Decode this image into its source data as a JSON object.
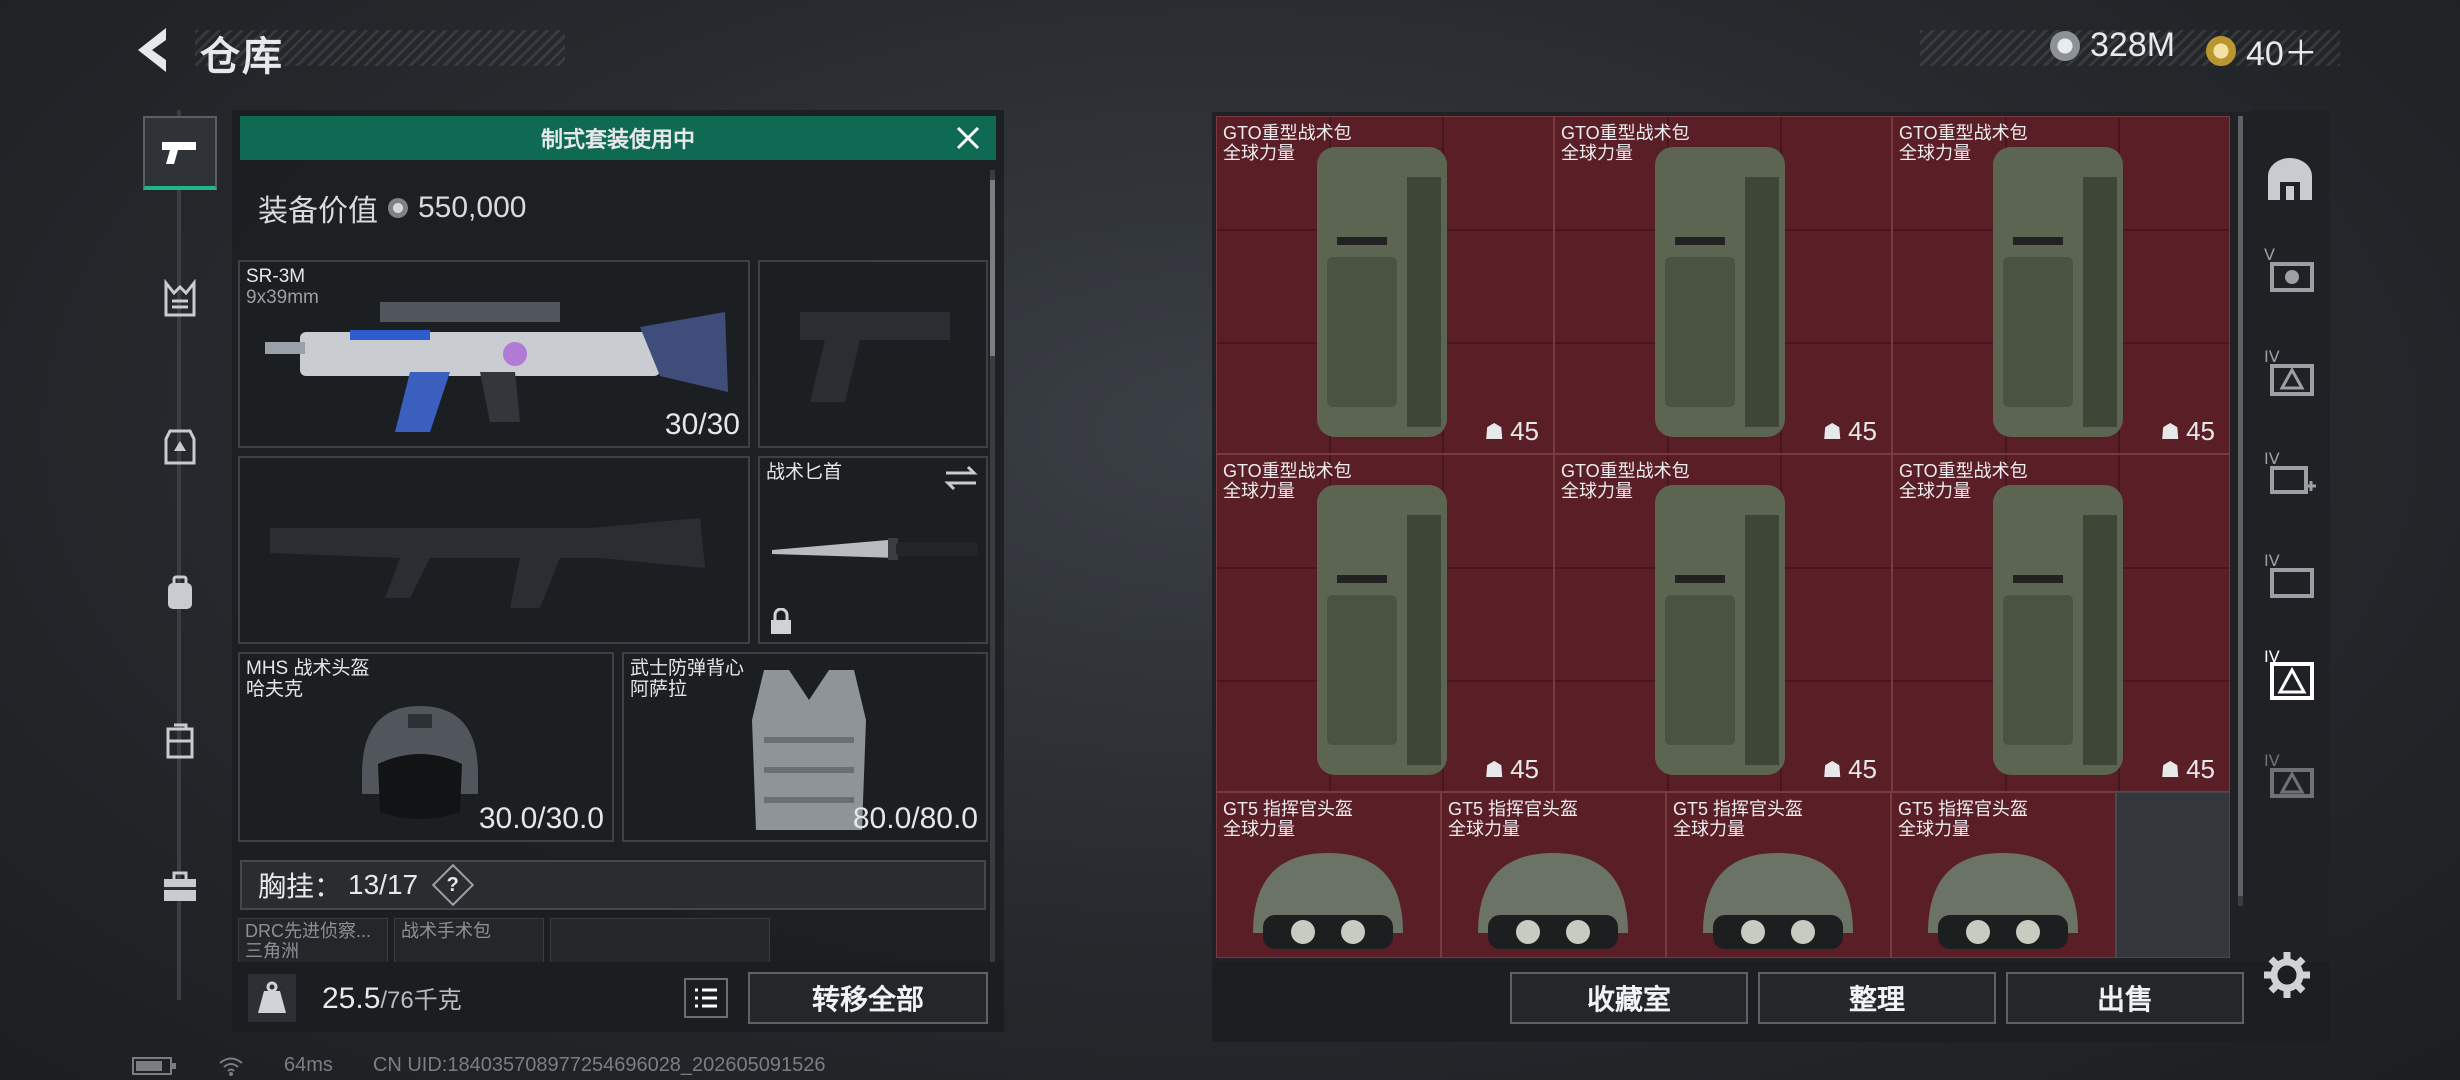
{
  "page": {
    "title": "仓库"
  },
  "currency": {
    "silver": "328M",
    "gold": "40＋"
  },
  "loadout": {
    "banner": "制式套装使用中",
    "value_label": "装备价值",
    "value": "550,000",
    "primary": {
      "name": "SR-3M",
      "caliber": "9x39mm",
      "ammo": "30/30"
    },
    "knife": {
      "name": "战术匕首"
    },
    "helmet": {
      "name": "MHS 战术头盔",
      "tier": "哈夫克",
      "durability": "30.0/30.0"
    },
    "armor": {
      "name": "武士防弹背心",
      "tier": "阿萨拉",
      "durability": "80.0/80.0"
    },
    "chest": {
      "label": "胸挂：",
      "count": "13/17",
      "help": "?"
    },
    "pouches": [
      {
        "name": "DRC先进侦察...",
        "sub": "三角洲"
      },
      {
        "name": "战术手术包"
      }
    ],
    "weight": {
      "current": "25.5",
      "max": "/76千克"
    },
    "transfer_all": "转移全部"
  },
  "storage": {
    "items": [
      {
        "name": "GTO重型战术包",
        "faction": "全球力量",
        "level": "45"
      },
      {
        "name": "GTO重型战术包",
        "faction": "全球力量",
        "level": "45"
      },
      {
        "name": "GTO重型战术包",
        "faction": "全球力量",
        "level": "45"
      },
      {
        "name": "GTO重型战术包",
        "faction": "全球力量",
        "level": "45"
      },
      {
        "name": "GTO重型战术包",
        "faction": "全球力量",
        "level": "45"
      },
      {
        "name": "GTO重型战术包",
        "faction": "全球力量",
        "level": "45"
      }
    ],
    "helmets": [
      {
        "name": "GT5 指挥官头盔",
        "faction": "全球力量"
      },
      {
        "name": "GT5 指挥官头盔",
        "faction": "全球力量"
      },
      {
        "name": "GT5 指挥官头盔",
        "faction": "全球力量"
      },
      {
        "name": "GT5 指挥官头盔",
        "faction": "全球力量"
      }
    ],
    "buttons": {
      "collection": "收藏室",
      "sort": "整理",
      "sell": "出售"
    }
  },
  "right_nav": {
    "tiers": [
      "V",
      "IV",
      "IV",
      "IV",
      "IV",
      "IV"
    ]
  },
  "status": {
    "ping": "64ms",
    "uid": "CN UID:18403570897725469602​8_202605091526"
  },
  "colors": {
    "accent": "#1fb58f",
    "banner": "#0e6a52",
    "item_bg": "#5a1f26"
  }
}
